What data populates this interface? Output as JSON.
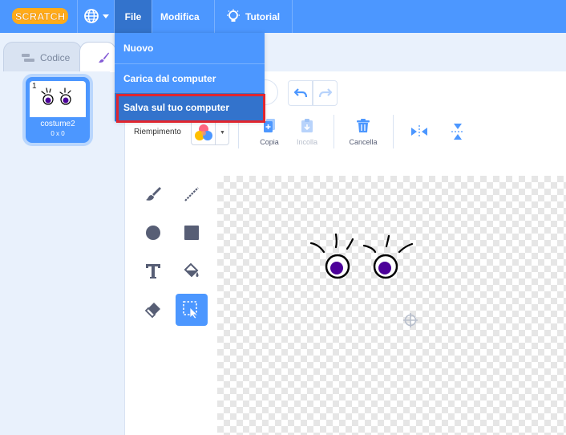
{
  "menubar": {
    "logo_text": "SCRATCH",
    "file_label": "File",
    "edit_label": "Modifica",
    "tutorial_label": "Tutorial"
  },
  "file_menu": {
    "items": [
      {
        "label": "Nuovo"
      },
      {
        "label": "Carica dal computer"
      },
      {
        "label": "Salva sul tuo computer"
      }
    ]
  },
  "tabs": {
    "code_label": "Codice",
    "costumes_label": ""
  },
  "costumes": [
    {
      "number": "1",
      "name": "costume2",
      "size": "0 x 0"
    }
  ],
  "editor": {
    "fill_label": "Riempimento",
    "copy_label": "Copia",
    "paste_label": "Incolla",
    "delete_label": "Cancella"
  },
  "colors": {
    "menubar": "#4c97ff",
    "menubar_active": "#3373cc",
    "highlight": "#e0262f",
    "accent_purple": "#855cd6",
    "eye_pupil": "#4c0099"
  }
}
